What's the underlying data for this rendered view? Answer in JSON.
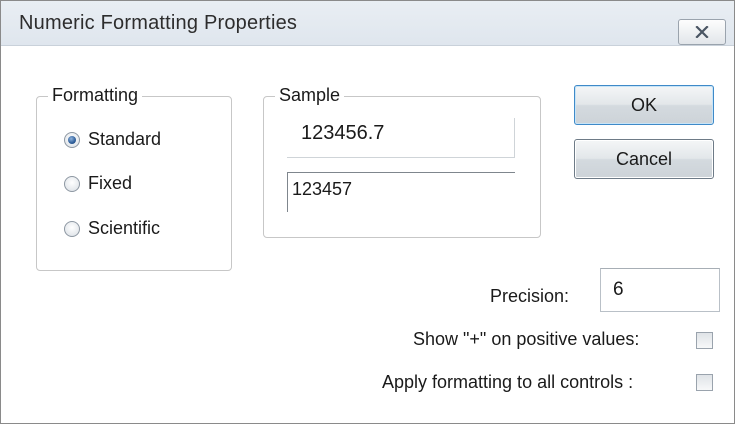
{
  "window": {
    "title": "Numeric Formatting Properties"
  },
  "formatting": {
    "group_label": "Formatting",
    "options": [
      {
        "label": "Standard",
        "checked": true
      },
      {
        "label": "Fixed",
        "checked": false
      },
      {
        "label": "Scientific",
        "checked": false
      }
    ]
  },
  "sample": {
    "group_label": "Sample",
    "input_value": "123456.7",
    "output_value": "123457"
  },
  "buttons": {
    "ok_label": "OK",
    "cancel_label": "Cancel"
  },
  "precision": {
    "label": "Precision:",
    "value": "6"
  },
  "options": {
    "show_plus_label": "Show \"+\" on positive values:",
    "show_plus_checked": false,
    "apply_all_label": "Apply formatting to all controls :",
    "apply_all_checked": false
  },
  "colors": {
    "titlebar": "#e3e9f0",
    "radio_selected": "#2d5d99",
    "default_button_border": "#3f8ac8"
  },
  "icons": {
    "close": "close-x-icon"
  }
}
